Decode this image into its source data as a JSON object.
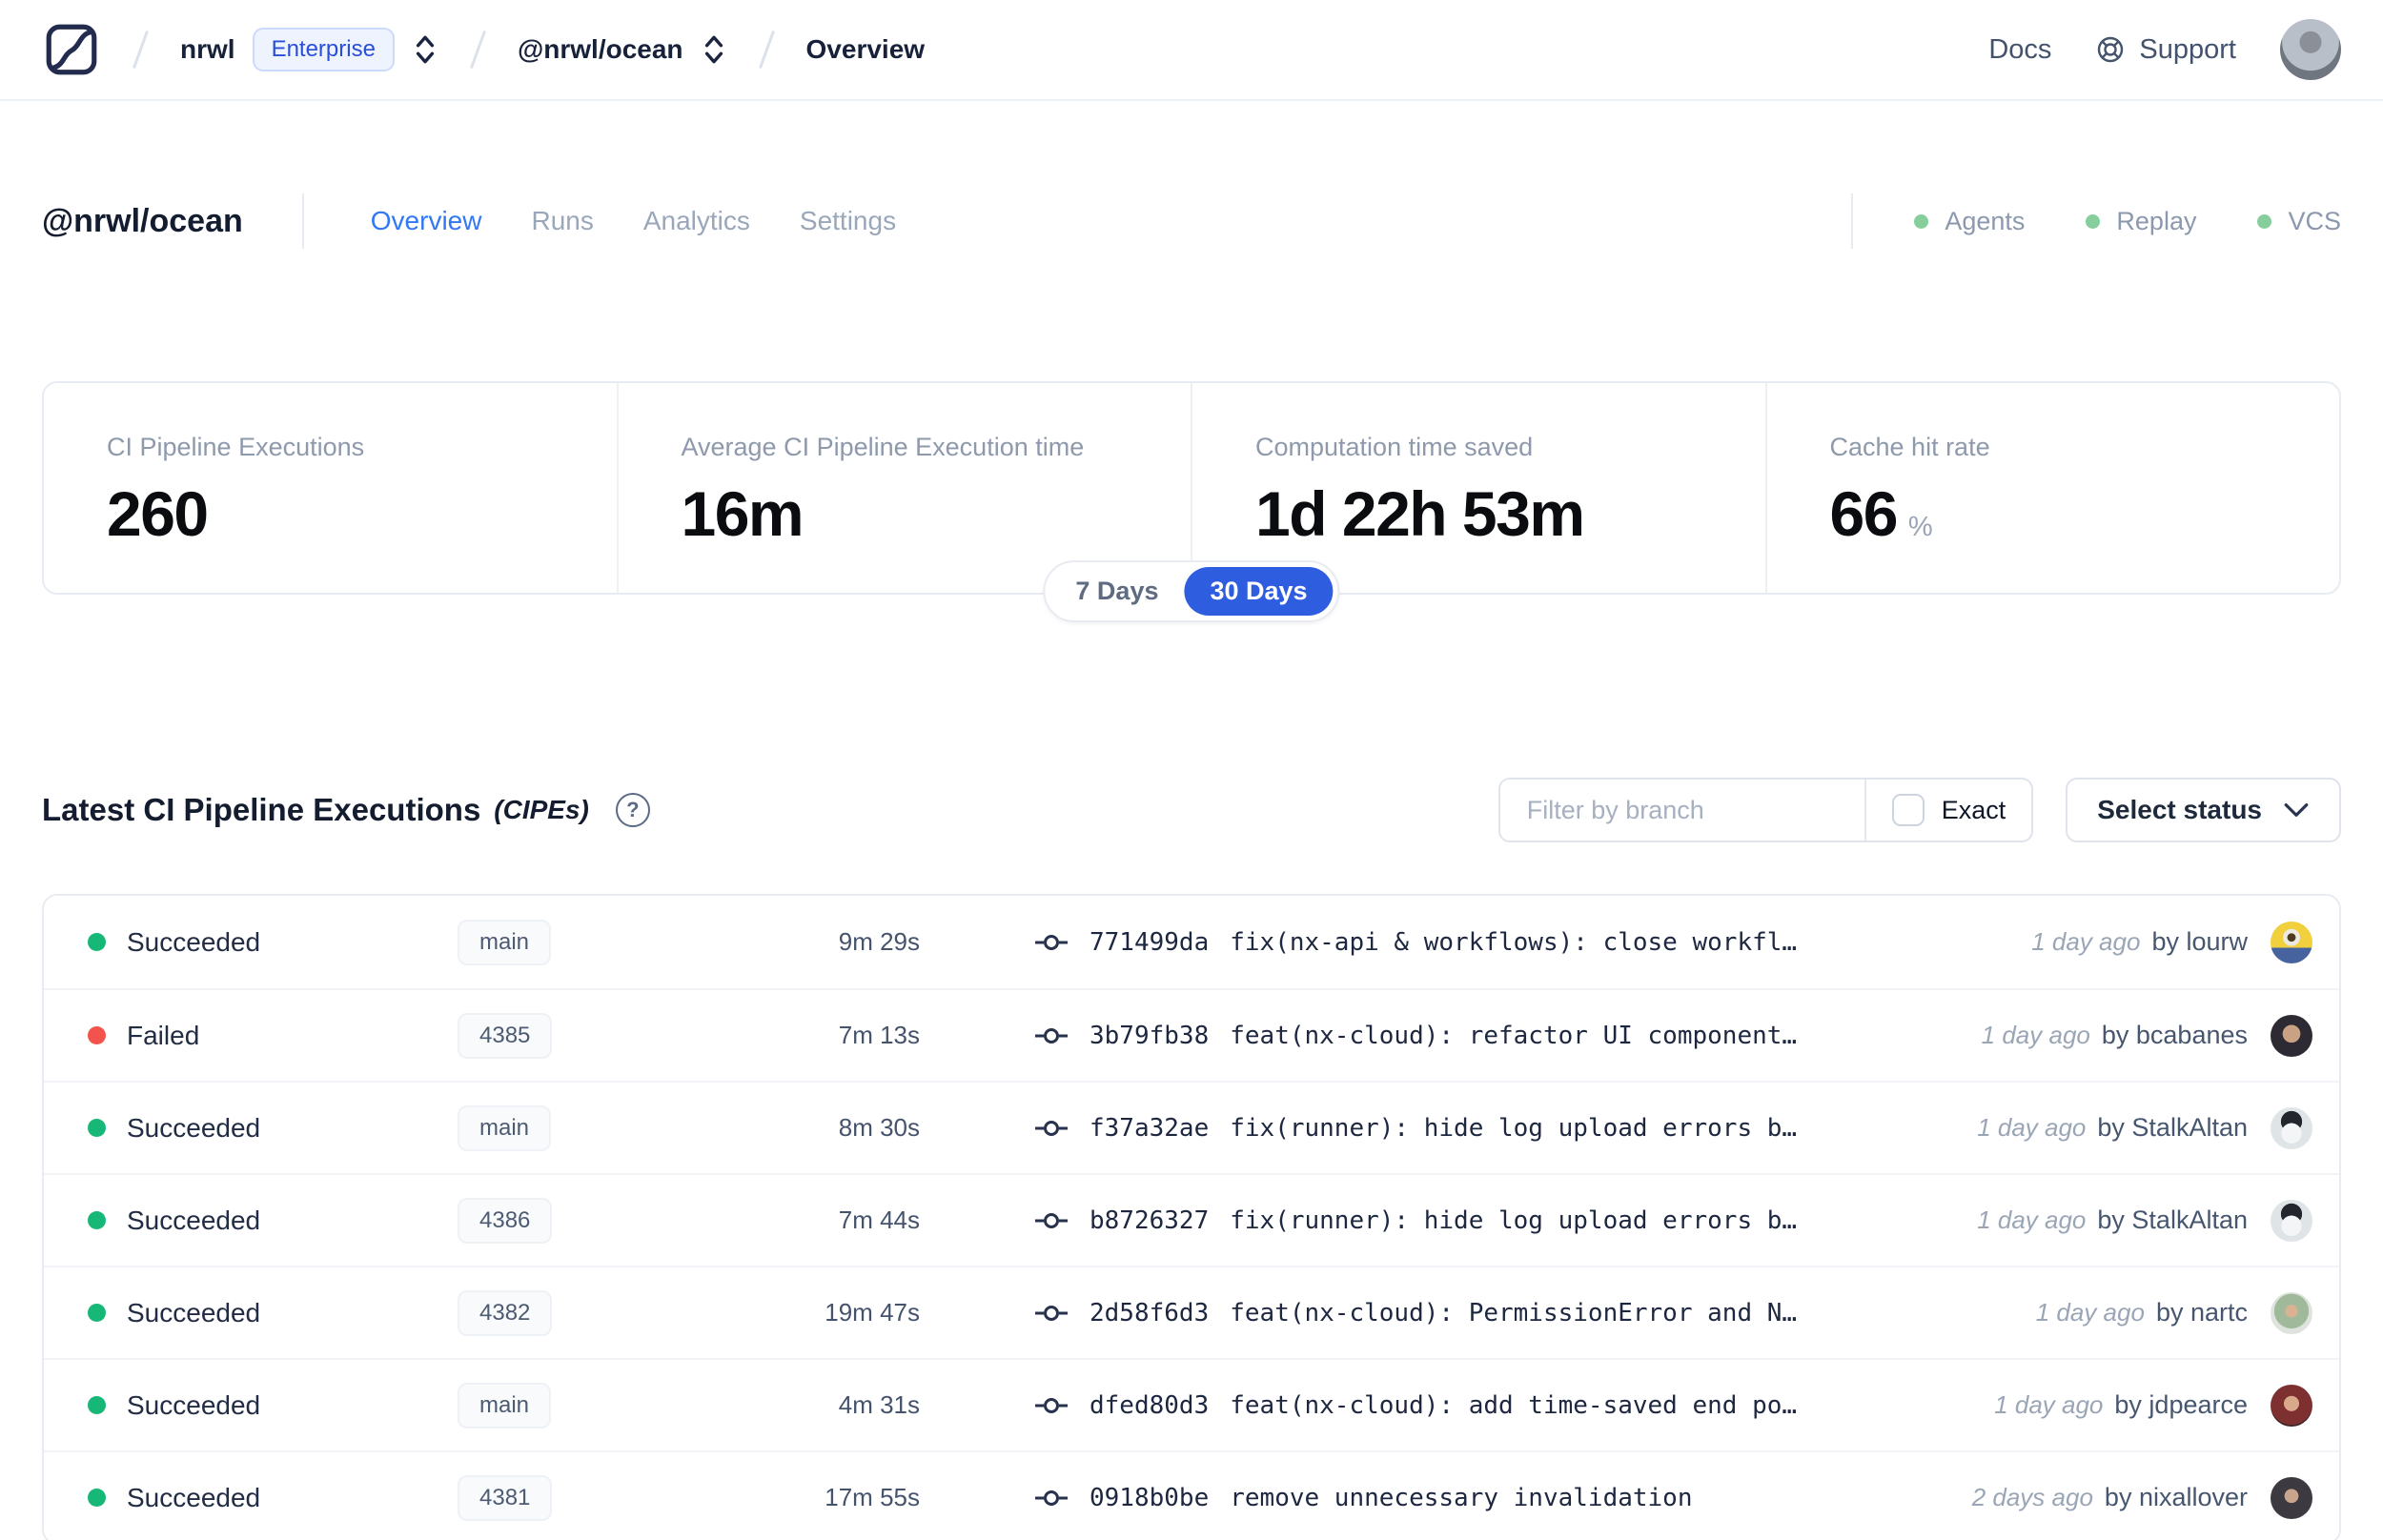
{
  "colors": {
    "accent_blue": "#2e5ddf",
    "tab_active_blue": "#3277f6",
    "enterprise_badge_blue": "#2a4fd7",
    "success_green": "#17b877",
    "failed_red": "#f2544d",
    "header_dot_green": "#86cf9c"
  },
  "nav": {
    "breadcrumb": {
      "org": "nrwl",
      "org_badge": "Enterprise",
      "workspace": "@nrwl/ocean",
      "page": "Overview"
    },
    "docs_label": "Docs",
    "support_label": "Support"
  },
  "header": {
    "title": "@nrwl/ocean",
    "tabs": [
      {
        "label": "Overview"
      },
      {
        "label": "Runs"
      },
      {
        "label": "Analytics"
      },
      {
        "label": "Settings"
      }
    ],
    "active_tab": "Overview",
    "status_indicators": [
      {
        "label": "Agents"
      },
      {
        "label": "Replay"
      },
      {
        "label": "VCS"
      }
    ]
  },
  "stats": {
    "cards": [
      {
        "label": "CI Pipeline Executions",
        "value": "260",
        "unit": ""
      },
      {
        "label": "Average CI Pipeline Execution time",
        "value": "16m",
        "unit": ""
      },
      {
        "label": "Computation time saved",
        "value": "1d 22h 53m",
        "unit": ""
      },
      {
        "label": "Cache hit rate",
        "value": "66",
        "unit": "%"
      }
    ],
    "range_toggle": {
      "options": [
        {
          "label": "7 Days"
        },
        {
          "label": "30 Days"
        }
      ],
      "selected": "30 Days"
    }
  },
  "cipe": {
    "title": "Latest CI Pipeline Executions",
    "title_suffix": "(CIPEs)",
    "filter": {
      "placeholder": "Filter by branch",
      "exact_label": "Exact",
      "exact_checked": false,
      "status_dropdown_label": "Select status"
    },
    "rows": [
      {
        "state": "succeeded",
        "status": "Succeeded",
        "branch": "main",
        "duration": "9m 29s",
        "commit_hash": "771499da",
        "commit_message": "fix(nx-api & workflows): close workfl…",
        "time_ago": "1 day ago",
        "author": "by lourw"
      },
      {
        "state": "failed",
        "status": "Failed",
        "branch": "4385",
        "duration": "7m 13s",
        "commit_hash": "3b79fb38",
        "commit_message": "feat(nx-cloud): refactor UI component…",
        "time_ago": "1 day ago",
        "author": "by bcabanes"
      },
      {
        "state": "succeeded",
        "status": "Succeeded",
        "branch": "main",
        "duration": "8m 30s",
        "commit_hash": "f37a32ae",
        "commit_message": "fix(runner): hide log upload errors b…",
        "time_ago": "1 day ago",
        "author": "by StalkAltan"
      },
      {
        "state": "succeeded",
        "status": "Succeeded",
        "branch": "4386",
        "duration": "7m 44s",
        "commit_hash": "b8726327",
        "commit_message": "fix(runner): hide log upload errors b…",
        "time_ago": "1 day ago",
        "author": "by StalkAltan"
      },
      {
        "state": "succeeded",
        "status": "Succeeded",
        "branch": "4382",
        "duration": "19m 47s",
        "commit_hash": "2d58f6d3",
        "commit_message": "feat(nx-cloud): PermissionError and N…",
        "time_ago": "1 day ago",
        "author": "by nartc"
      },
      {
        "state": "succeeded",
        "status": "Succeeded",
        "branch": "main",
        "duration": "4m 31s",
        "commit_hash": "dfed80d3",
        "commit_message": "feat(nx-cloud): add time-saved end po…",
        "time_ago": "1 day ago",
        "author": "by jdpearce"
      },
      {
        "state": "succeeded",
        "status": "Succeeded",
        "branch": "4381",
        "duration": "17m 55s",
        "commit_hash": "0918b0be",
        "commit_message": "remove unnecessary invalidation",
        "time_ago": "2 days ago",
        "author": "by nixallover"
      }
    ]
  }
}
